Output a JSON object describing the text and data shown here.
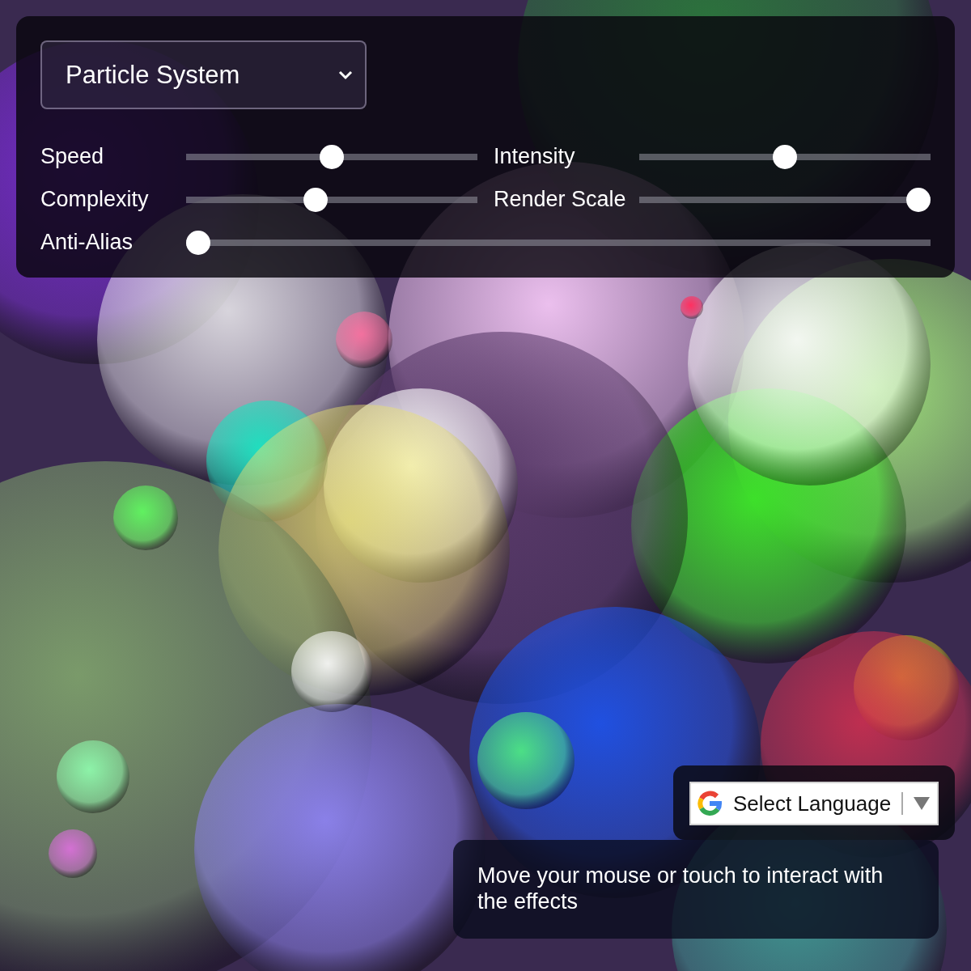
{
  "effect_select": {
    "value": "Particle System"
  },
  "sliders": [
    {
      "label": "Speed",
      "level": 0.5
    },
    {
      "label": "Intensity",
      "level": 0.5
    },
    {
      "label": "Complexity",
      "level": 0.44
    },
    {
      "label": "Render Scale",
      "level": 1
    },
    {
      "label": "Anti-Alias",
      "level": 0
    }
  ],
  "language_select": {
    "label": "Select Language"
  },
  "hint": "Move your mouse or touch to interact with the effects"
}
